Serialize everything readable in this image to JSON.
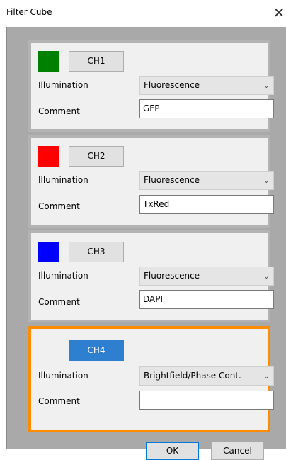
{
  "window": {
    "title": "Filter Cube",
    "close_glyph": "✕"
  },
  "labels": {
    "illumination": "Illumination",
    "comment": "Comment"
  },
  "channels": [
    {
      "name": "CH1",
      "color": "#008000",
      "illumination": "Fluorescence",
      "comment": "GFP"
    },
    {
      "name": "CH2",
      "color": "#ff0000",
      "illumination": "Fluorescence",
      "comment": "TxRed"
    },
    {
      "name": "CH3",
      "color": "#0000ff",
      "illumination": "Fluorescence",
      "comment": "DAPI"
    },
    {
      "name": "CH4",
      "color": "",
      "illumination": "Brightfield/Phase Cont.",
      "comment": "",
      "active": true
    }
  ],
  "colors": {
    "active_border": "#ff8c00",
    "active_button": "#2f7fd1"
  },
  "buttons": {
    "ok": "OK",
    "cancel": "Cancel"
  }
}
